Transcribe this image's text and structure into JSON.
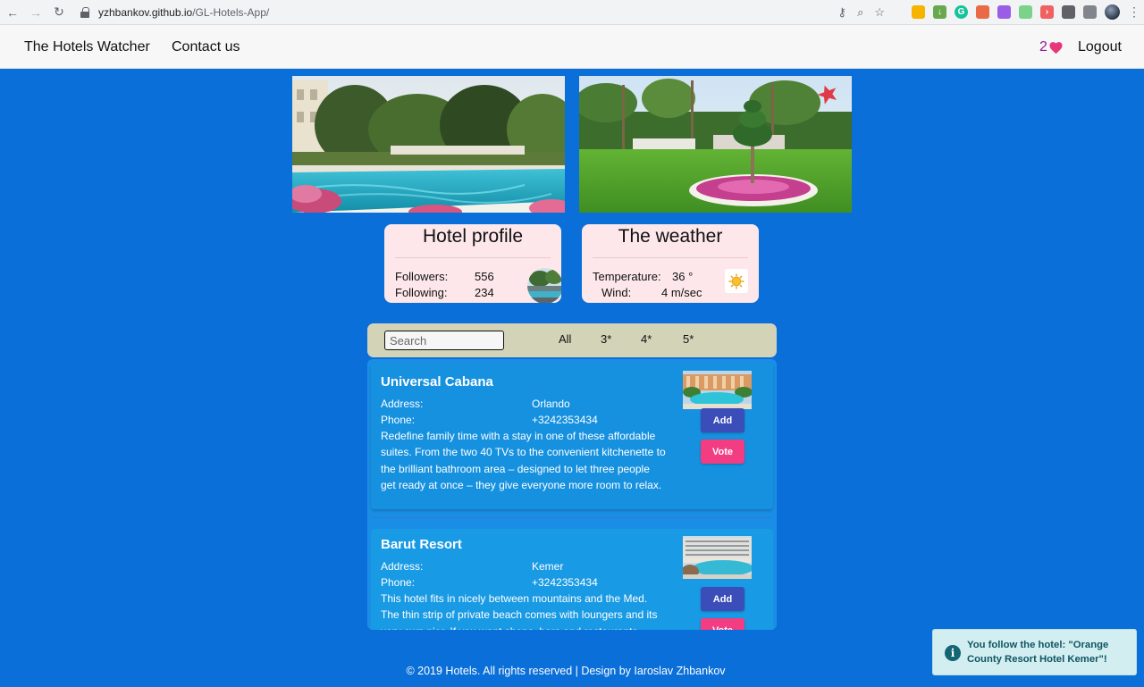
{
  "browser": {
    "url_host": "yzhbankov.github.io",
    "url_path": "/GL-Hotels-App/"
  },
  "header": {
    "brand": "The Hotels Watcher",
    "contact": "Contact us",
    "favorites_count": "2",
    "logout": "Logout"
  },
  "profile_card": {
    "title": "Hotel profile",
    "followers_label": "Followers:",
    "followers_value": "556",
    "following_label": "Following:",
    "following_value": "234"
  },
  "weather_card": {
    "title": "The weather",
    "temperature_label": "Temperature:",
    "temperature_value": "36 °",
    "wind_label": "Wind:",
    "wind_value": "4 m/sec",
    "icon": "sun-icon"
  },
  "filters": {
    "search_placeholder": "Search",
    "search_value": "",
    "options": [
      "All",
      "3*",
      "4*",
      "5*"
    ]
  },
  "hotels": [
    {
      "name": "Universal Cabana",
      "address_label": "Address:",
      "address": "Orlando",
      "phone_label": "Phone:",
      "phone": "+3242353434",
      "description": "Redefine family time with a stay in one of these affordable suites. From the two 40 TVs to the convenient kitchenette to the brilliant bathroom area – designed to let three people get ready at once – they give everyone more room to relax.",
      "add_label": "Add",
      "vote_label": "Vote"
    },
    {
      "name": "Barut Resort",
      "address_label": "Address:",
      "address": "Kemer",
      "phone_label": "Phone:",
      "phone": "+3242353434",
      "description": "This hotel fits in nicely between mountains and the Med. The thin strip of private beach comes with loungers and its very own pier. If you want shops, bars and restaurants",
      "add_label": "Add",
      "vote_label": "Vote"
    }
  ],
  "footer": {
    "text": "© 2019 Hotels. All rights reserved | Design by Iaroslav Zhbankov"
  },
  "toast": {
    "text": "You follow the hotel: \"Orange County Resort Hotel Kemer\"!"
  },
  "colors": {
    "page_background": "#0a6fd8",
    "card_background": "#fde7ea",
    "filter_bar": "#d3d3b8",
    "add_button": "#3b4db8",
    "vote_button": "#f23d83",
    "favorites": "#8e1b94",
    "toast_background": "#d3eef0"
  }
}
